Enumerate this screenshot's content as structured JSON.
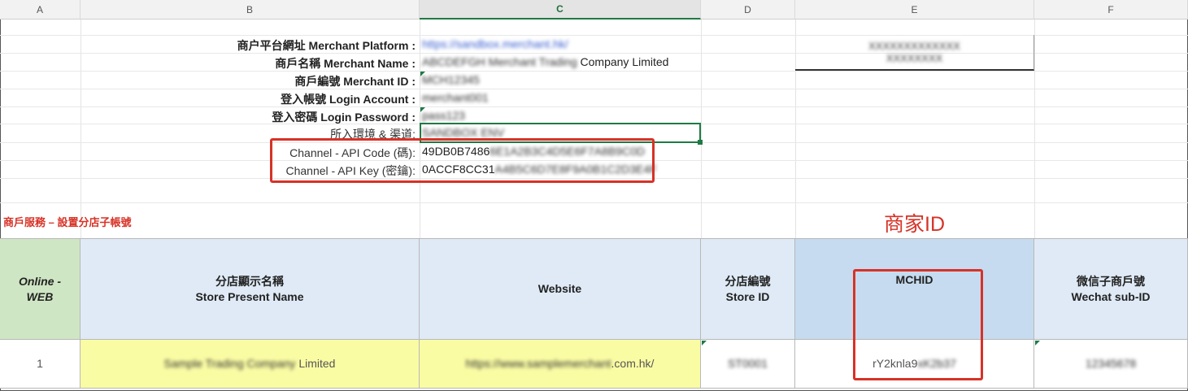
{
  "columns": [
    "A",
    "B",
    "C",
    "D",
    "E",
    "F"
  ],
  "info": {
    "merchant_platform_label": "商户平台網址 Merchant Platform :",
    "merchant_platform_value": "https://sandbox.merchant.hk/",
    "merchant_name_label": "商戶名稱 Merchant Name :",
    "merchant_name_value_blur": "ABCDEFGH Merchant Trading",
    "merchant_name_value_tail": "Company Limited",
    "merchant_id_label": "商戶編號 Merchant ID :",
    "merchant_id_value": "MCH12345",
    "login_account_label": "登入帳號 Login Account :",
    "login_account_value": "merchant001",
    "login_password_label": "登入密碼 Login Password :",
    "login_password_value": "pass123",
    "env_label": "所入環境 & 渠道:",
    "env_value": "SANDBOX ENV",
    "api_code_label": "Channel - API Code (碼):",
    "api_code_value_visible": "49DB0B7486",
    "api_code_value_blur": "6E1A2B3C4D5E6F7A8B9C0D",
    "api_key_label": "Channel - API Key (密鑰):",
    "api_key_value_visible": "0ACCF8CC31",
    "api_key_value_blur": "A4B5C6D7E8F9A0B1C2D3E4F"
  },
  "side_box": {
    "line1": "XXXXXXXXXXXXX",
    "line2": "XXXXXXXX"
  },
  "section_title": "商戶服務 – 設置分店子帳號",
  "annotation": "商家ID",
  "table": {
    "headers": {
      "online_web": "Online - WEB",
      "store_name_zh": "分店顯示名稱",
      "store_name_en": "Store Present Name",
      "website": "Website",
      "store_id_zh": "分店編號",
      "store_id_en": "Store ID",
      "mchid": "MCHID",
      "wechat_zh": "微信子商戶號",
      "wechat_en": "Wechat sub-ID"
    },
    "row": {
      "index": "1",
      "store_name_blur": "Sample Trading Company",
      "store_name_tail": "Limited",
      "website_blur": "https://www.samplemerchant",
      "website_tail": ".com.hk/",
      "store_id": "ST0001",
      "mchid_visible": "rY2knla9",
      "mchid_blur": "xK2b37",
      "wechat": "12345678"
    }
  },
  "colors": {
    "highlight_red": "#d73227",
    "header_green": "#cfe6c4",
    "header_blue": "#dfeaf6",
    "header_blue_selected": "#c6dbef",
    "row_yellow": "#fafca4"
  }
}
